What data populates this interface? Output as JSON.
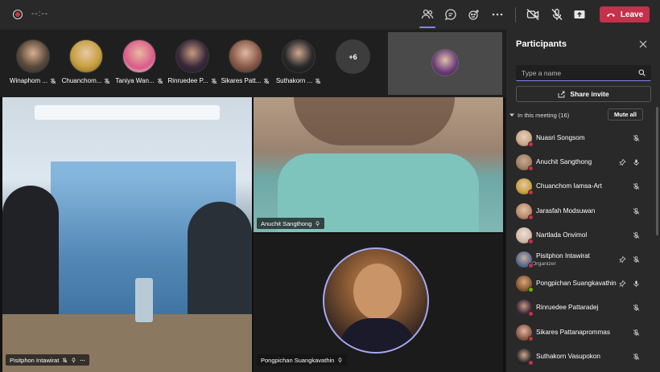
{
  "topbar": {
    "timer": "--:--",
    "leave_label": "Leave",
    "icons": [
      "record-icon",
      "people-icon",
      "chat-icon",
      "reactions-icon",
      "more-icon",
      "video-off-icon",
      "mic-off-icon",
      "share-tray-icon",
      "phone-icon"
    ],
    "accent": "#7f85f5",
    "leave_color": "#c4314b"
  },
  "strip": {
    "participants": [
      {
        "name": "Winaphom ...",
        "color": "#5a4a3a"
      },
      {
        "name": "Chuanchom...",
        "color": "#c8a040"
      },
      {
        "name": "Taniya Wan...",
        "color": "#d85a8a"
      },
      {
        "name": "Rinruedee P...",
        "color": "#3a2a3a"
      },
      {
        "name": "Sikares Patt...",
        "color": "#8a5a4a"
      },
      {
        "name": "Suthakorn ...",
        "color": "#2a2a2a"
      }
    ],
    "more_count": "+6"
  },
  "videos": [
    {
      "name": "Pisitphon Intawirat"
    },
    {
      "name": "Anuchit Sangthong"
    },
    {
      "name": "Pongpichan Suangkavathin"
    }
  ],
  "panel": {
    "title": "Participants",
    "search_placeholder": "Type a name",
    "share_label": "Share invite",
    "section_label": "In this meeting (16)",
    "mute_all_label": "Mute all",
    "participants": [
      {
        "name": "Nuasri Songsom",
        "role": "",
        "status": "red",
        "color": "#c9a78a"
      },
      {
        "name": "Anuchit Sangthong",
        "role": "",
        "status": "red",
        "color": "#a08064"
      },
      {
        "name": "Chuanchom Iamsa-Art",
        "role": "",
        "status": "red",
        "color": "#c8a040"
      },
      {
        "name": "Jarasfah Modsuwan",
        "role": "",
        "status": "red",
        "color": "#b98a6a"
      },
      {
        "name": "Nartlada Onvimol",
        "role": "",
        "status": "red",
        "color": "#d0b8a8"
      },
      {
        "name": "Pisitphon Intawirat",
        "role": "Organizer",
        "status": "red",
        "color": "#5a6a8a"
      },
      {
        "name": "Pongpichan Suangkavathin",
        "role": "",
        "status": "green",
        "color": "#8a5a34"
      },
      {
        "name": "Rinruedee Pattaradej",
        "role": "",
        "status": "red",
        "color": "#3a2a3a"
      },
      {
        "name": "Sikares Pattanaprommas",
        "role": "",
        "status": "red",
        "color": "#8a5a4a"
      },
      {
        "name": "Suthakorn Vasupokon",
        "role": "",
        "status": "red",
        "color": "#2a2a2a"
      }
    ]
  }
}
